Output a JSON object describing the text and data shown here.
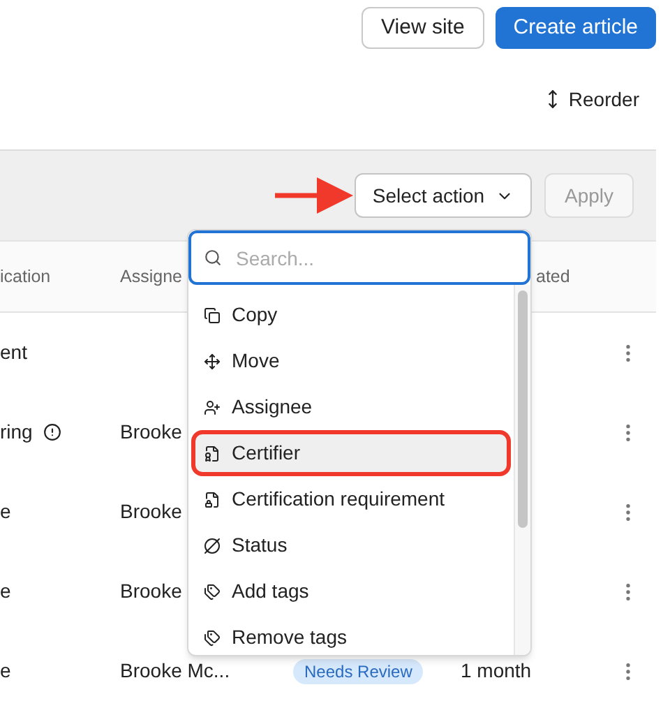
{
  "header": {
    "buttons": [
      {
        "label": "View site",
        "kind": "secondary"
      },
      {
        "label": "Create article",
        "kind": "primary"
      }
    ]
  },
  "reorder": {
    "label": "Reorder"
  },
  "toolbar": {
    "select": {
      "label": "Select action"
    },
    "apply": {
      "label": "Apply",
      "disabled": true
    },
    "annotation_arrow": true
  },
  "table": {
    "columns": [
      "ication",
      "Assigne",
      "",
      "ated"
    ],
    "rows": [
      {
        "column_1": "ent",
        "warning": false,
        "assignee": "",
        "badge": "",
        "updated": ""
      },
      {
        "column_1": "ring",
        "warning": true,
        "assignee": "Brooke",
        "badge": "",
        "updated": ""
      },
      {
        "column_1": "e",
        "warning": false,
        "assignee": "Brooke",
        "badge": "",
        "updated": ""
      },
      {
        "column_1": "e",
        "warning": false,
        "assignee": "Brooke",
        "badge": "",
        "updated": ""
      },
      {
        "column_1": "e",
        "warning": false,
        "assignee": "Brooke Mc...",
        "badge": "Needs Review",
        "updated": "1 month"
      }
    ]
  },
  "dropdown": {
    "search": {
      "placeholder": "Search..."
    },
    "items": [
      {
        "label": "Copy",
        "highlighted": false
      },
      {
        "label": "Move",
        "highlighted": false
      },
      {
        "label": "Assignee",
        "highlighted": false
      },
      {
        "label": "Certifier",
        "highlighted": true
      },
      {
        "label": "Certification requirement",
        "highlighted": false
      },
      {
        "label": "Status",
        "highlighted": false
      },
      {
        "label": "Add tags",
        "highlighted": false
      },
      {
        "label": "Remove tags",
        "highlighted": false
      }
    ]
  }
}
